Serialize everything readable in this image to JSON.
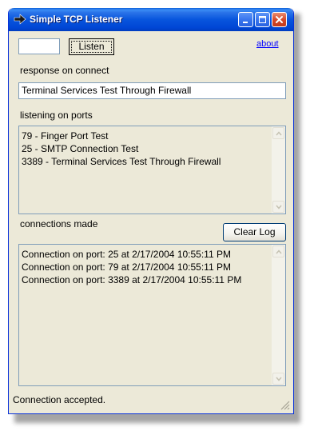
{
  "window": {
    "title": "Simple TCP Listener",
    "title_icon": "arrow-right-icon",
    "controls": [
      "minimize-icon",
      "maximize-icon",
      "close-icon"
    ]
  },
  "toolbar": {
    "port_value": "",
    "listen_label": "Listen",
    "about_label": "about"
  },
  "response": {
    "label": "response on connect",
    "value": "Terminal Services Test Through Firewall"
  },
  "ports": {
    "label": "listening on ports",
    "items": [
      "79 - Finger Port Test",
      "25 - SMTP Connection Test",
      "3389 - Terminal Services Test Through Firewall"
    ]
  },
  "connections": {
    "label": "connections made",
    "clear_label": "Clear Log",
    "items": [
      "Connection on port: 25 at 2/17/2004 10:55:11 PM",
      "Connection on port: 79 at 2/17/2004 10:55:11 PM",
      "Connection on port: 3389 at 2/17/2004 10:55:11 PM"
    ]
  },
  "status": {
    "text": "Connection accepted."
  },
  "colors": {
    "title_bar": "#0855dd",
    "window_face": "#ece9d8",
    "link": "#0000ff",
    "close_button": "#d6492a"
  }
}
